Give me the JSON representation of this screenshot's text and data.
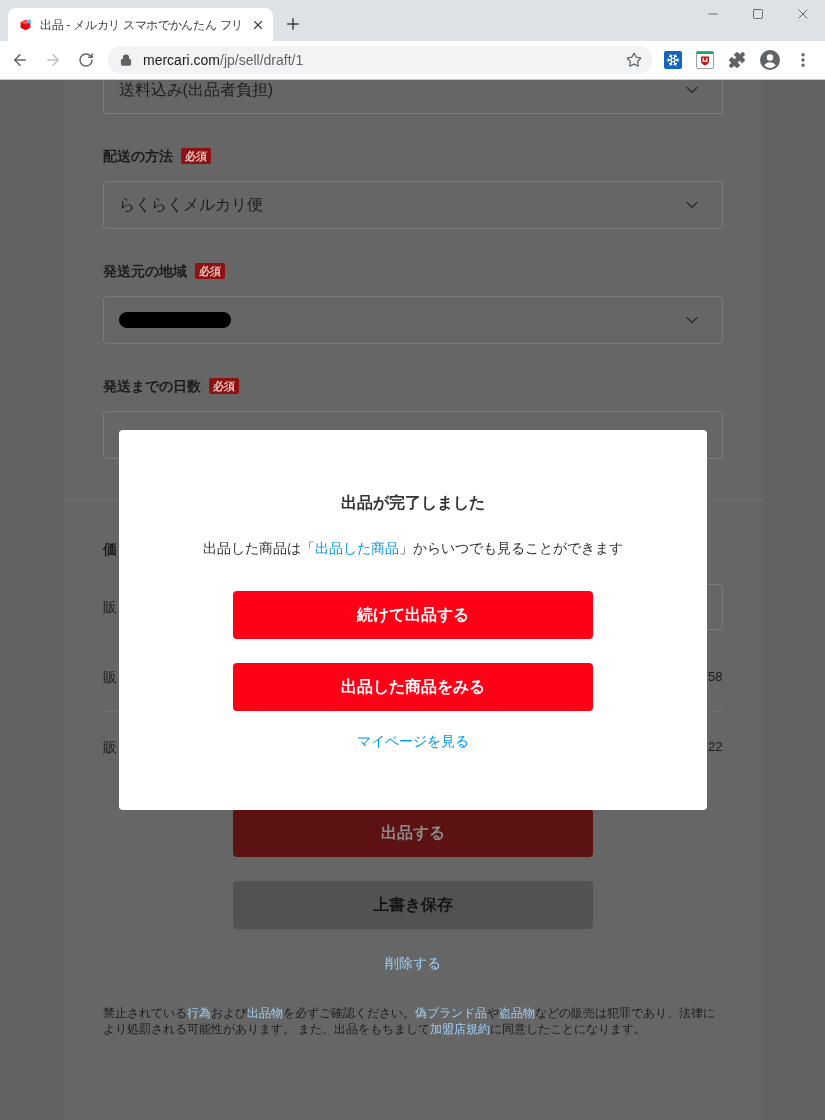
{
  "browser": {
    "tab": {
      "title": "出品 - メルカリ スマホでかんたん フリ"
    },
    "address": {
      "host": "mercari.com",
      "path": "/jp/sell/draft/1"
    }
  },
  "form": {
    "fields": [
      {
        "value": "送料込み(出品者負担)",
        "redacted": false
      },
      {
        "label": "配送の方法",
        "badge": "必須",
        "value": "らくらくメルカリ便",
        "redacted": false
      },
      {
        "label": "発送元の地域",
        "badge": "必須",
        "redacted": true
      },
      {
        "label": "発送までの日数",
        "badge": "必須",
        "redacted": false
      }
    ],
    "price": {
      "title": "価",
      "rows": [
        {
          "kind": "input",
          "label": "販"
        },
        {
          "kind": "value",
          "label": "販",
          "value": "58"
        },
        {
          "kind": "value",
          "label": "販",
          "value": "22"
        }
      ]
    },
    "submit_button": "出品する",
    "save_button": "上書き保存",
    "delete_link": "削除する",
    "notice": [
      {
        "kind": "text",
        "text": "禁止されている"
      },
      {
        "kind": "link",
        "text": "行為"
      },
      {
        "kind": "text",
        "text": "および"
      },
      {
        "kind": "link",
        "text": "出品物"
      },
      {
        "kind": "text",
        "text": "を必ずご確認ください。"
      },
      {
        "kind": "link",
        "text": "偽ブランド品"
      },
      {
        "kind": "text",
        "text": "や"
      },
      {
        "kind": "link",
        "text": "盗品物"
      },
      {
        "kind": "text",
        "text": "などの販売は犯罪であり、法律により処罰される可能性があります。 また、出品をもちまして"
      },
      {
        "kind": "link",
        "text": "加盟店規約"
      },
      {
        "kind": "text",
        "text": "に同意したことになります。"
      }
    ]
  },
  "modal": {
    "title": "出品が完了しました",
    "message": [
      {
        "kind": "text",
        "text": "出品した商品は「"
      },
      {
        "kind": "link",
        "text": "出品した商品"
      },
      {
        "kind": "text",
        "text": "」からいつでも見ることができます"
      }
    ],
    "buttons": [
      "続けて出品する",
      "出品した商品をみる"
    ],
    "link": "マイページを見る"
  }
}
